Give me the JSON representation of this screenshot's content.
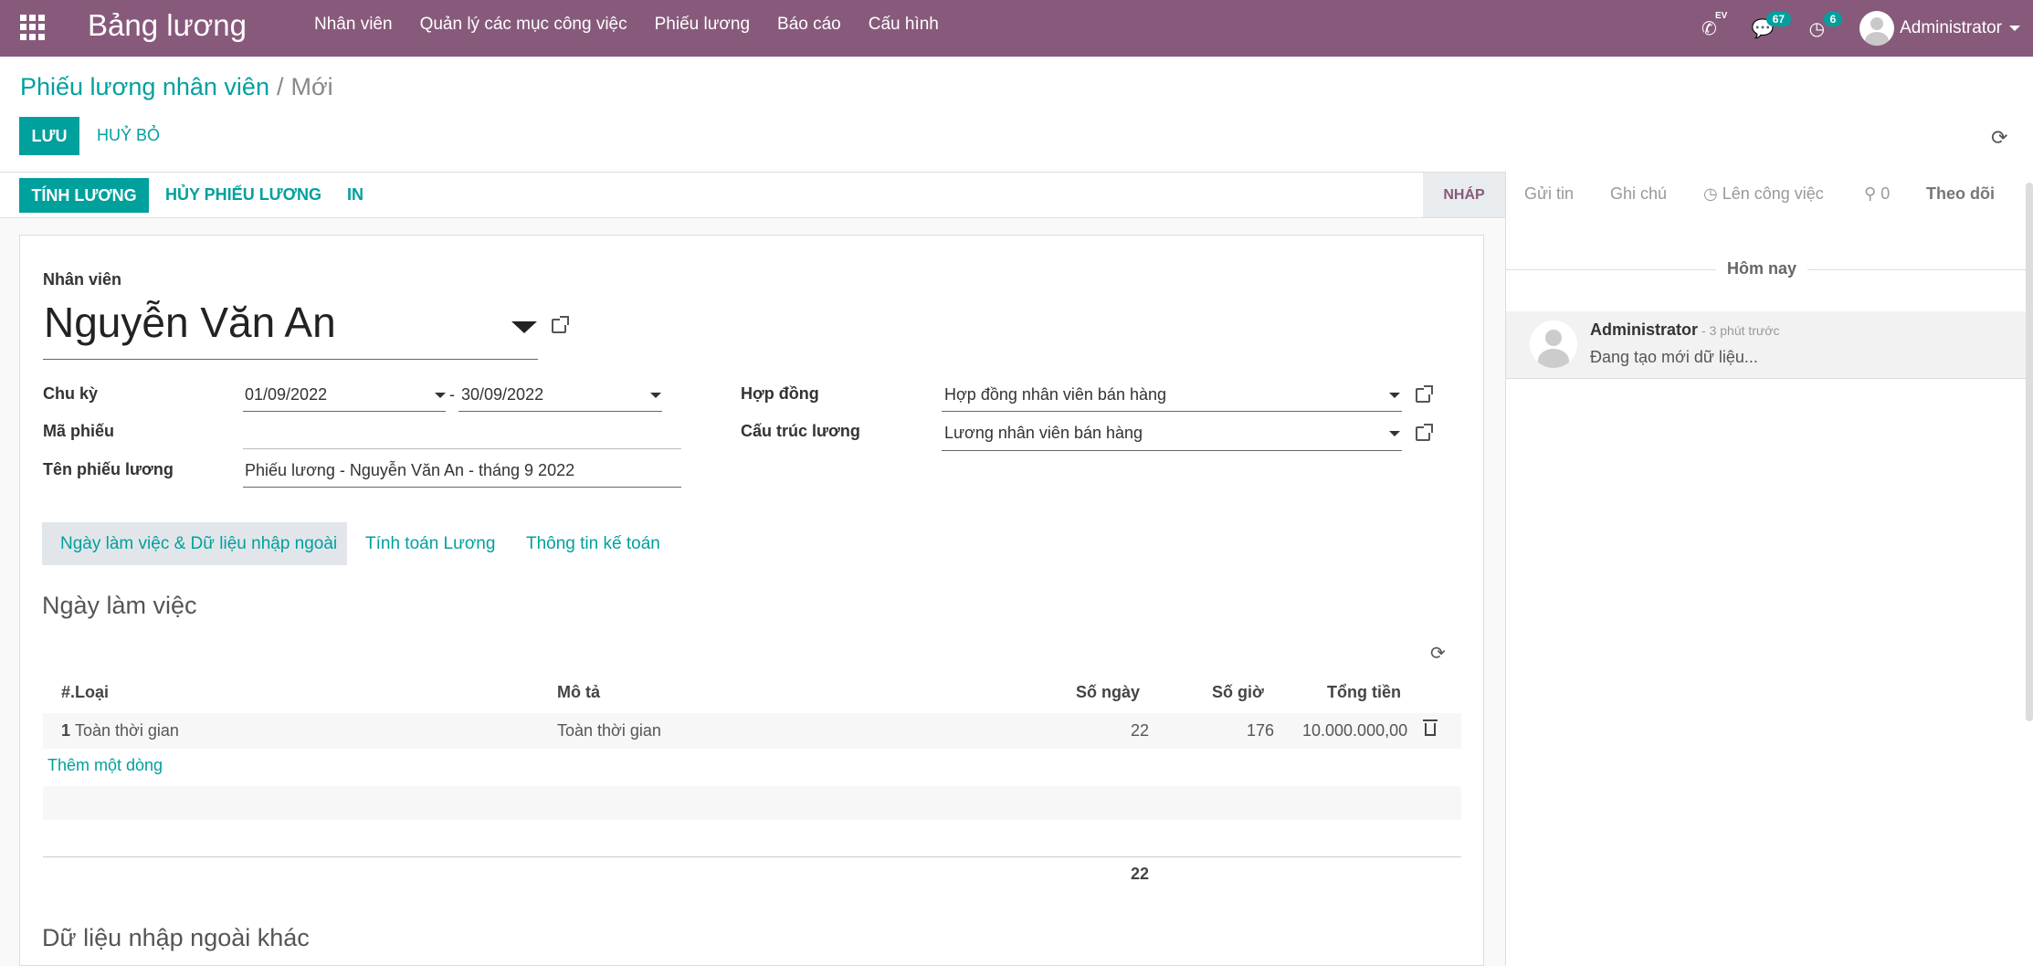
{
  "navbar": {
    "brand": "Bảng lương",
    "menu": [
      "Nhân viên",
      "Quản lý các mục công việc",
      "Phiếu lương",
      "Báo cáo",
      "Cấu hình"
    ],
    "ev_label": "EV",
    "messages_count": "67",
    "activities_count": "6",
    "user_name": "Administrator",
    "bg_color": "#875A7B"
  },
  "breadcrumb": {
    "parent": "Phiếu lương nhân viên",
    "separator": "/",
    "current": "Mới"
  },
  "actions": {
    "save": "LƯU",
    "discard": "HUỶ BỎ"
  },
  "statusbar": {
    "compute": "TÍNH LƯƠNG",
    "cancel": "HỦY PHIẾU LƯƠNG",
    "print": "IN",
    "stage": "NHÁP"
  },
  "form": {
    "employee_label": "Nhân viên",
    "employee_name": "Nguyễn Văn An",
    "period_label": "Chu kỳ",
    "date_from": "01/09/2022",
    "date_sep": "-",
    "date_to": "30/09/2022",
    "ref_label": "Mã phiếu",
    "ref_value": "",
    "name_label": "Tên phiếu lương",
    "name_value": "Phiếu lương - Nguyễn Văn An - tháng 9 2022",
    "contract_label": "Hợp đồng",
    "contract_value": "Hợp đồng nhân viên bán hàng",
    "struct_label": "Cấu trúc lương",
    "struct_value": "Lương nhân viên bán hàng"
  },
  "tabs": [
    "Ngày làm việc & Dữ liệu nhập ngoài",
    "Tính toán Lương",
    "Thông tin kế toán"
  ],
  "worked_days": {
    "title": "Ngày làm việc",
    "columns": {
      "seq_type": "#.Loại",
      "desc": "Mô tả",
      "days": "Số ngày",
      "hours": "Số giờ",
      "amount": "Tổng tiền"
    },
    "rows": [
      {
        "seq": "1",
        "type": "Toàn thời gian",
        "desc": "Toàn thời gian",
        "days": "22",
        "hours": "176",
        "amount": "10.000.000,00"
      }
    ],
    "add_line": "Thêm một dòng",
    "total_days": "22"
  },
  "inputs_section_title": "Dữ liệu nhập ngoài khác",
  "chatter": {
    "send_message": "Gửi tin",
    "log_note": "Ghi chú",
    "schedule": "Lên công việc",
    "attachments": "0",
    "follow": "Theo dõi",
    "today": "Hôm nay",
    "message": {
      "author": "Administrator",
      "time": "- 3 phút trước",
      "body": "Đang tạo mới dữ liệu..."
    }
  }
}
